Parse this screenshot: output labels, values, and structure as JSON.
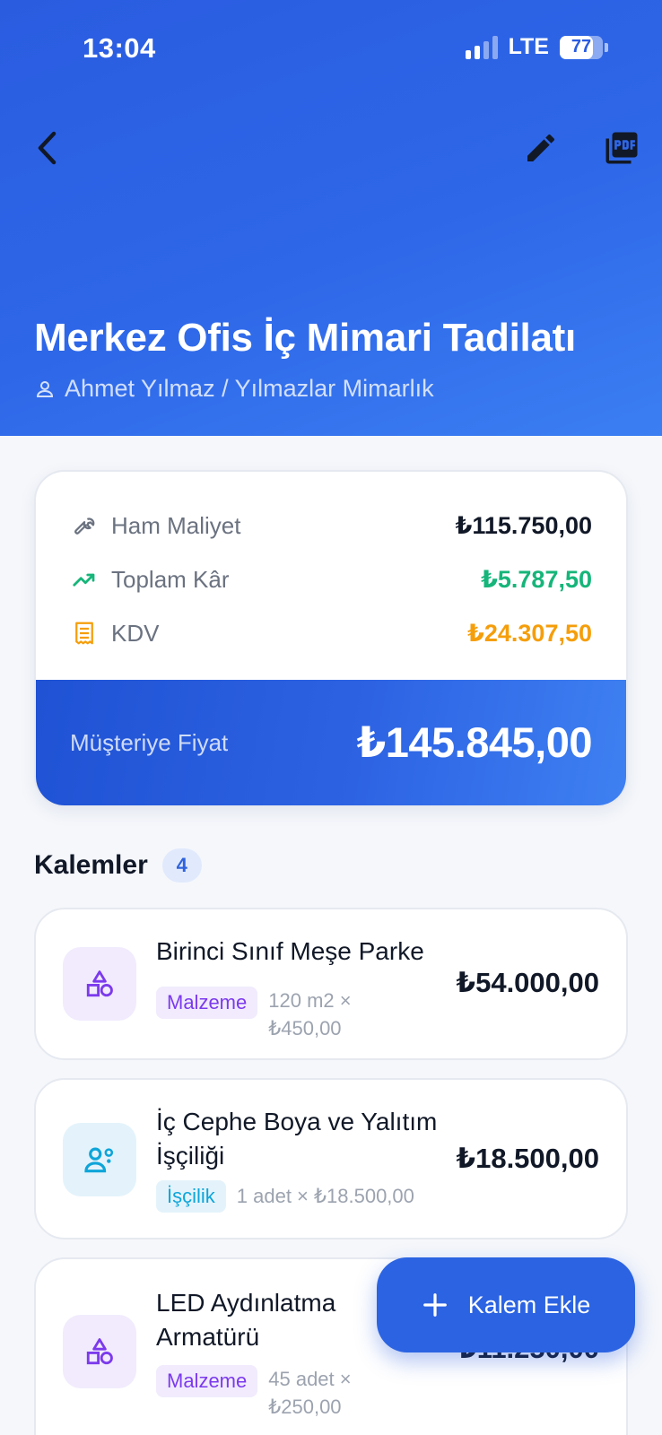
{
  "status_bar": {
    "time": "13:04",
    "network": "LTE",
    "battery": "77",
    "battery_level": 0.77
  },
  "header": {
    "title": "Merkez Ofis İç Mimari Tadilatı",
    "client": "Ahmet Yılmaz / Yılmazlar Mimarlık"
  },
  "summary": {
    "rows": [
      {
        "label": "Ham Maliyet",
        "value": "₺115.750,00",
        "icon": "wrench-icon",
        "color": "#111827"
      },
      {
        "label": "Toplam Kâr",
        "value": "₺5.787,50",
        "icon": "trending-up-icon",
        "color": "#16a34a"
      },
      {
        "label": "KDV",
        "value": "₺24.307,50",
        "icon": "receipt-icon",
        "color": "#f59e0b"
      }
    ],
    "customer_price_label": "Müşteriye Fiyat",
    "customer_price": "₺145.845,00"
  },
  "items_section": {
    "title": "Kalemler",
    "count": "4",
    "items": [
      {
        "name": "Birinci Sınıf Meşe Parke",
        "tag": "Malzeme",
        "qty_line1": "120 m2 ×",
        "qty_line2": "₺450,00",
        "total": "₺54.000,00",
        "type": "material"
      },
      {
        "name_line1": "İç Cephe Boya ve Yalıtım",
        "name_line2": "İşçiliği",
        "tag": "İşçilik",
        "qty": "1 adet × ₺18.500,00",
        "total": "₺18.500,00",
        "type": "labor"
      },
      {
        "name_line1": "LED Aydınlatma",
        "name_line2": "Armatürü",
        "tag": "Malzeme",
        "qty_line1": "45 adet ×",
        "qty_line2": "₺250,00",
        "total": "₺11.250,00",
        "type": "material"
      }
    ]
  },
  "fab": {
    "label": "Kalem Ekle"
  }
}
